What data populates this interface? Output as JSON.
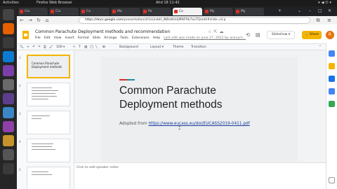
{
  "topbar": {
    "activities": "Activities",
    "app_name": "Firefox Web Browser",
    "clock": "Ahd 18 11:42",
    "tray_icons": [
      "network-icon",
      "volume-icon",
      "power-icon",
      "chevron-down-icon"
    ]
  },
  "dock": {
    "apps": [
      {
        "name": "terminal-icon",
        "color": "#444444"
      },
      {
        "name": "firefox-icon",
        "color": "#e66000"
      },
      {
        "name": "screenshot-icon",
        "color": "#3a3a3a"
      },
      {
        "name": "vscode-icon",
        "color": "#0a7bd0"
      },
      {
        "name": "settings-icon",
        "color": "#7a3fa8"
      },
      {
        "name": "files-icon",
        "color": "#6a6a6a"
      },
      {
        "name": "presentation-icon",
        "color": "#5b3f8c"
      },
      {
        "name": "chat-icon",
        "color": "#3b86c6"
      },
      {
        "name": "media-icon",
        "color": "#8e3fa8"
      },
      {
        "name": "notes-icon",
        "color": "#c7932a"
      },
      {
        "name": "trash-icon",
        "color": "#555555"
      },
      {
        "name": "apps-grid-icon",
        "color": "#3a3a3a"
      }
    ]
  },
  "browser": {
    "tabs": [
      {
        "label": "Cia",
        "active": false
      },
      {
        "label": "Cia",
        "active": false
      },
      {
        "label": "Ca",
        "active": false
      },
      {
        "label": "Ma",
        "active": false
      },
      {
        "label": "Pa",
        "active": false
      },
      {
        "label": "Co",
        "active": true
      },
      {
        "label": "My",
        "active": false
      },
      {
        "label": "My",
        "active": false
      }
    ],
    "url_host": "https://docs.google.com",
    "url_path": "/presentation/d/1sLkvbH_lNBaWsHjMNFRb7avTQ/edit#slide=id.p"
  },
  "docs": {
    "title": "Common Parachute Deployment methods and recommendation",
    "menus": [
      "File",
      "Edit",
      "View",
      "Insert",
      "Format",
      "Slide",
      "Arrange",
      "Tools",
      "Extensions",
      "Help"
    ],
    "last_edit": "Last edit was made on June 27, 2022 by anonym...",
    "slideshow_label": "Slideshow",
    "share_label": "Share",
    "avatar_letter": "R",
    "toolbar": {
      "zoom": "100",
      "background": "Background",
      "layout": "Layout",
      "theme": "Theme",
      "transition": "Transition"
    },
    "slides": [
      {
        "number": "1",
        "title": "Common Parachute Deployment methods",
        "selected": true
      },
      {
        "number": "2",
        "title": "",
        "selected": false
      },
      {
        "number": "3",
        "title": "",
        "selected": false
      },
      {
        "number": "4",
        "title": "",
        "selected": false
      },
      {
        "number": "5",
        "title": "",
        "selected": false
      }
    ],
    "current_slide": {
      "title_line1": "Common Parachute",
      "title_line2": "Deployment methods",
      "subtitle_prefix": "Adopted from",
      "subtitle_link": "https://www.eucass.eu/doi/EUCASS2019-0411.pdf"
    },
    "speaker_notes_placeholder": "Click to add speaker notes",
    "side_panel": [
      {
        "name": "calendar-icon",
        "color": "#4285f4"
      },
      {
        "name": "keep-icon",
        "color": "#f4b400"
      },
      {
        "name": "tasks-icon",
        "color": "#1a73e8"
      },
      {
        "name": "contacts-icon",
        "color": "#4285f4"
      },
      {
        "name": "maps-icon",
        "color": "#34a853"
      }
    ]
  }
}
